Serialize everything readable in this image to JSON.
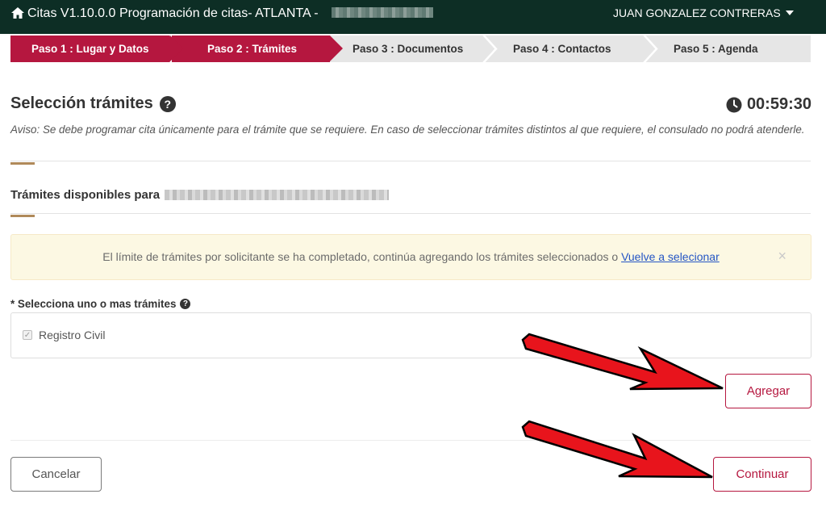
{
  "header": {
    "app_name": "Citas V1.10.0.0",
    "page_title": "Programación de citas- ATLANTA -",
    "user_name": "JUAN GONZALEZ CONTRERAS",
    "home_icon": "home-icon",
    "menu_icon": "caret-down-icon"
  },
  "steps": [
    {
      "label": "Paso 1 : Lugar y Datos",
      "state": "done"
    },
    {
      "label": "Paso 2 : Trámites",
      "state": "active"
    },
    {
      "label": "Paso 3 : Documentos",
      "state": "pending"
    },
    {
      "label": "Paso 4 : Contactos",
      "state": "pending"
    },
    {
      "label": "Paso 5 : Agenda",
      "state": "pending"
    }
  ],
  "section": {
    "title": "Selección trámites",
    "help_icon": "question-circle-icon",
    "timer": "00:59:30",
    "timer_icon": "clock-icon",
    "notice": "Aviso: Se debe programar cita únicamente para el trámite que se requiere. En caso de seleccionar trámites distintos al que requiere, el consulado no podrá atenderle.",
    "subtitle": "Trámites disponibles para"
  },
  "alert": {
    "message": "El límite de trámites por solicitante se ha completado, continúa agregando los trámites seleccionados o",
    "link": "Vuelve a selecionar",
    "close": "×"
  },
  "form": {
    "label": "* Selecciona uno o mas trámites",
    "help_icon": "question-circle-icon",
    "options": [
      {
        "label": "Registro Civil",
        "checked": true,
        "disabled": true
      }
    ]
  },
  "buttons": {
    "add": "Agregar",
    "cancel": "Cancelar",
    "continue": "Continuar"
  },
  "colors": {
    "header_bg": "#0d2e25",
    "step_active": "#b5173f",
    "step_inactive": "#e6e6e6",
    "accent": "#b08a5a",
    "alert_bg": "#fcf8e3",
    "annotation_arrow": "#e8141c"
  }
}
